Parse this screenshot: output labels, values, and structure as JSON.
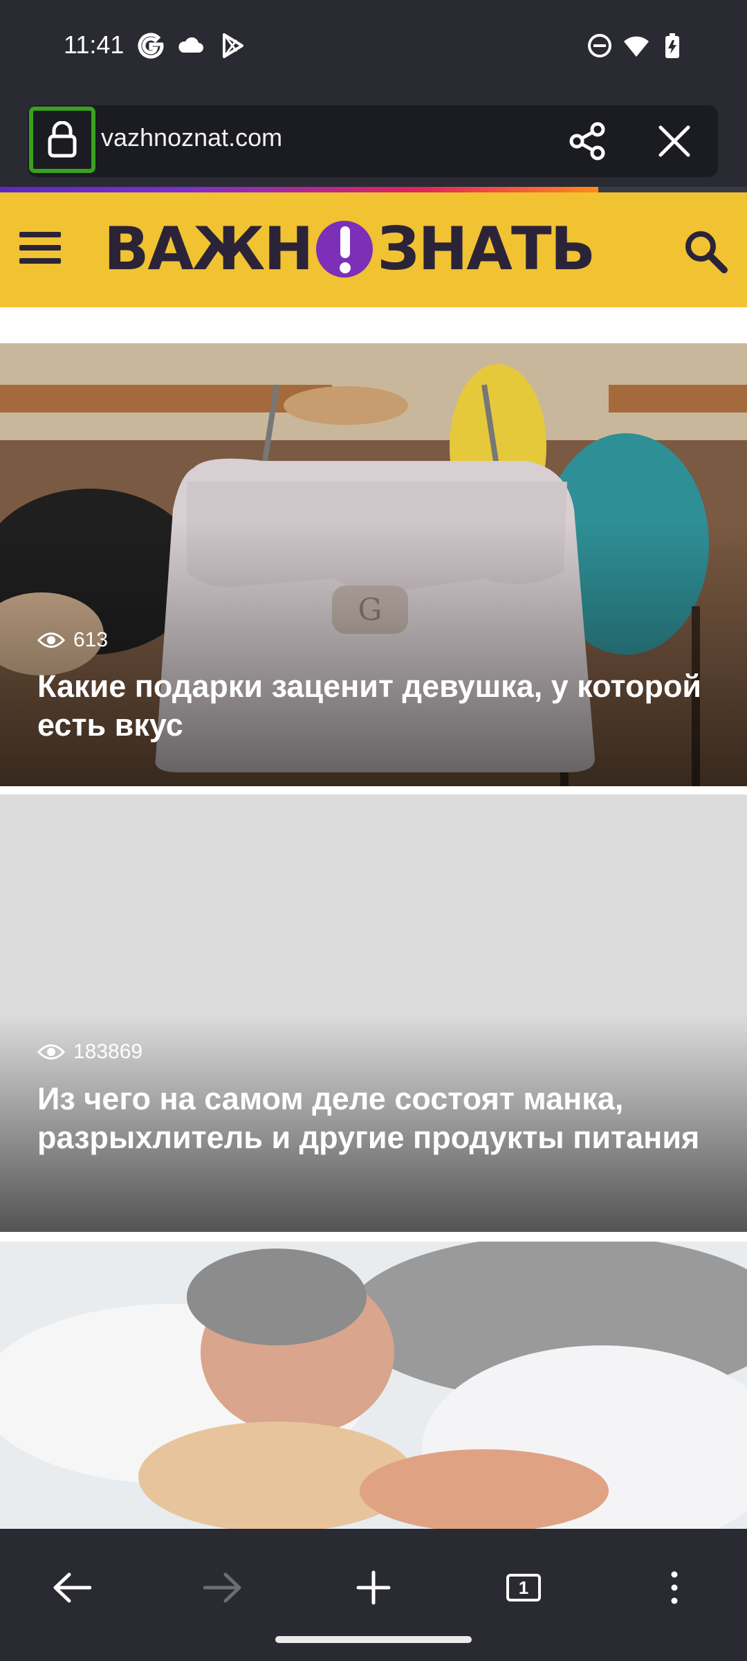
{
  "status_bar": {
    "time": "11:41",
    "left_icons": [
      "google-icon",
      "cloud-icon",
      "play-store-icon"
    ],
    "right_icons": [
      "dnd-icon",
      "wifi-icon",
      "battery-icon"
    ]
  },
  "browser": {
    "url": "vazhnoznat.com",
    "lock_highlight_color": "#3aa11e",
    "progress_colors": [
      "#5b2bbd",
      "#e0245e",
      "#ff8a1c"
    ]
  },
  "site": {
    "logo_left": "ВАЖН",
    "logo_right": "ЗНАТЬ",
    "header_color": "#f1c232",
    "logo_mark_color": "#7d2fb7"
  },
  "articles": [
    {
      "views": "613",
      "title": "Какие подарки заценит девушка, у которой есть вкус"
    },
    {
      "views": "183869",
      "title": "Из чего на самом деле состоят манка, разрыхлитель и другие продукты питания"
    },
    {
      "views": "",
      "title": ""
    }
  ],
  "toolbar": {
    "tab_count": "1",
    "icons": [
      "back-arrow-icon",
      "forward-arrow-icon",
      "plus-icon",
      "tabs-icon",
      "more-vert-icon"
    ]
  }
}
